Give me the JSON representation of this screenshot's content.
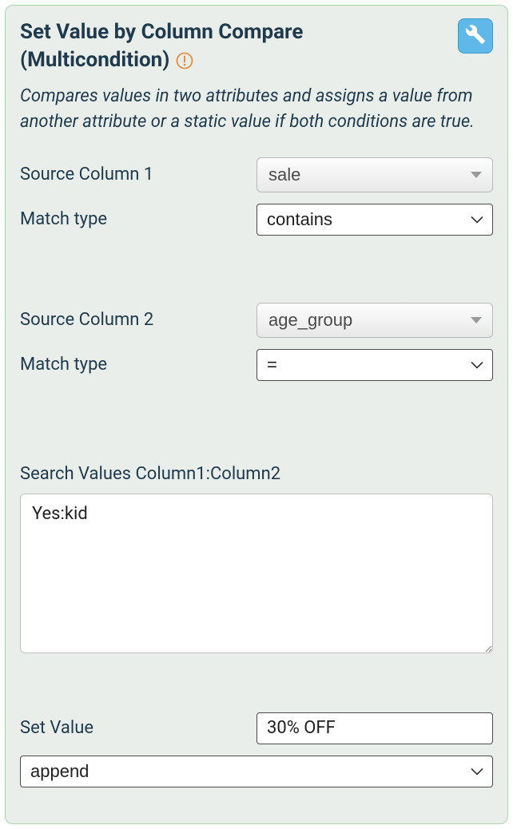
{
  "panel": {
    "title": "Set Value by Column Compare (Multicondition)",
    "description": "Compares values in two attributes and assigns a value from another attribute or a static value if both conditions are true."
  },
  "fields": {
    "source_column_1": {
      "label": "Source Column 1",
      "value": "sale"
    },
    "match_type_1": {
      "label": "Match type",
      "value": "contains"
    },
    "source_column_2": {
      "label": "Source Column 2",
      "value": "age_group"
    },
    "match_type_2": {
      "label": "Match type",
      "value": "="
    },
    "search_values": {
      "label": "Search Values Column1:Column2",
      "value": "Yes:kid"
    },
    "set_value": {
      "label": "Set Value",
      "value": "30% OFF"
    },
    "mode": {
      "value": "append"
    }
  }
}
